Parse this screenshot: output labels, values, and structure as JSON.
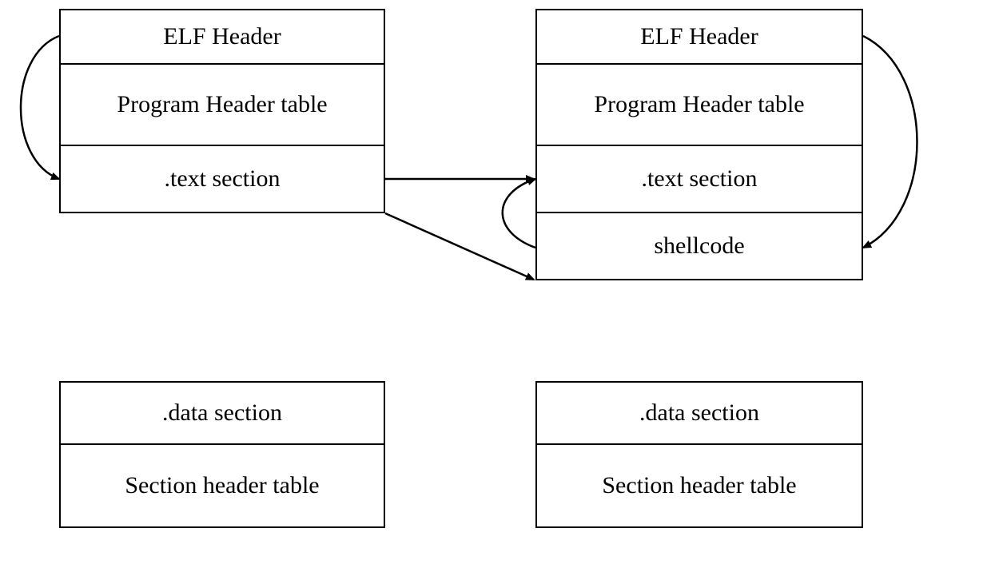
{
  "left": {
    "elf_header": "ELF Header",
    "program_header": "Program Header table",
    "text_section": ".text section",
    "data_section": ".data section",
    "section_header": "Section header table"
  },
  "right": {
    "elf_header": "ELF Header",
    "program_header": "Program Header table",
    "text_section": ".text section",
    "shellcode": "shellcode",
    "data_section": ".data section",
    "section_header": "Section header table"
  }
}
